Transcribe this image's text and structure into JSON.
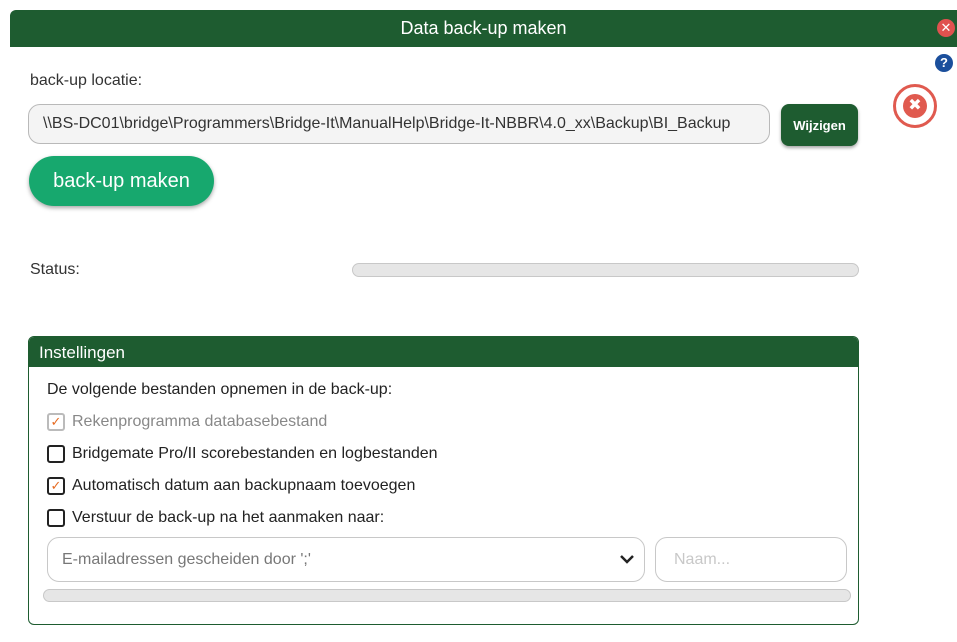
{
  "window": {
    "title": "Data back-up maken"
  },
  "location": {
    "label": "back-up locatie:",
    "path": "\\\\BS-DC01\\bridge\\Programmers\\Bridge-It\\ManualHelp\\Bridge-It-NBBR\\4.0_xx\\Backup\\BI_Backup",
    "change_label": "Wijzigen"
  },
  "backup_button": "back-up maken",
  "status": {
    "label": "Status:",
    "progress": 0
  },
  "settings": {
    "title": "Instellingen",
    "intro": "De volgende bestanden opnemen in de back-up:",
    "options": [
      {
        "label": "Rekenprogramma databasebestand",
        "checked": true,
        "disabled": true
      },
      {
        "label": "Bridgemate Pro/II scorebestanden en logbestanden",
        "checked": false,
        "disabled": false
      },
      {
        "label": "Automatisch datum aan backupnaam toevoegen",
        "checked": true,
        "disabled": false
      },
      {
        "label": "Verstuur de back-up na het aanmaken naar:",
        "checked": false,
        "disabled": false
      }
    ],
    "email_placeholder": "E-mailadressen gescheiden door ';'",
    "name_placeholder": "Naam...",
    "send_progress": 0
  },
  "icons": {
    "help": "question-circle-icon",
    "close": "close-circle-icon",
    "chevron": "chevron-down-icon"
  },
  "colors": {
    "header_green": "#1e5c30",
    "button_green": "#17a86e",
    "close_red": "#e05a4f",
    "check_orange": "#e66b22",
    "help_blue": "#1b4f9c"
  }
}
